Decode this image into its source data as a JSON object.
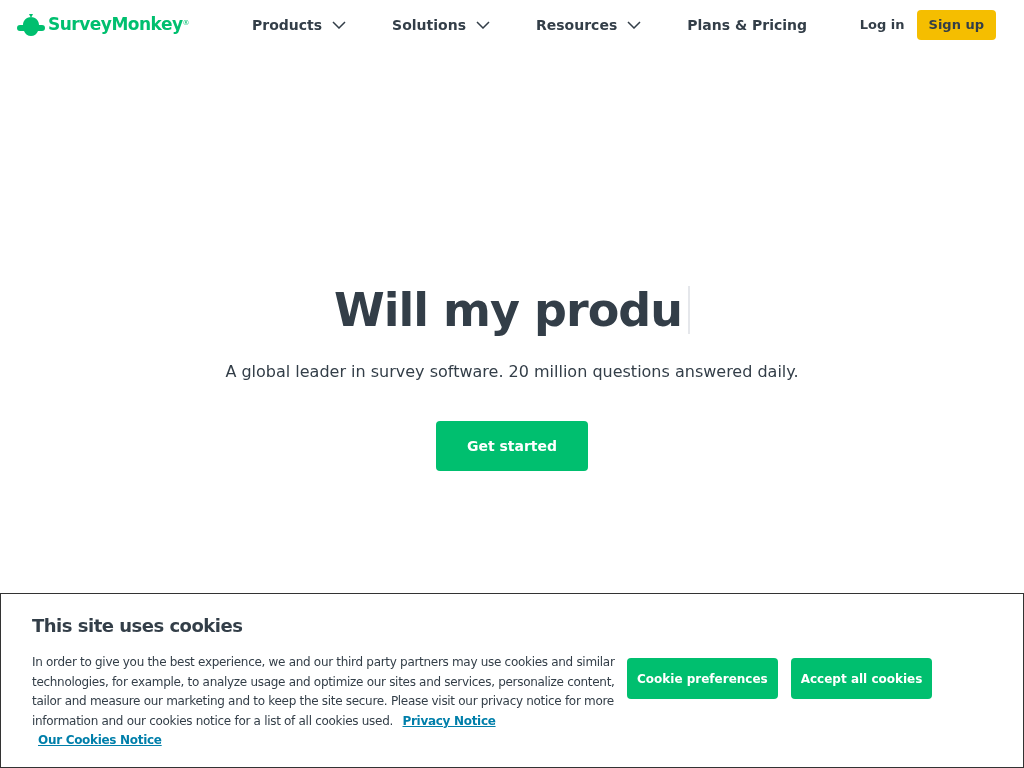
{
  "header": {
    "logo": "SurveyMonkey",
    "logo_mark": "®",
    "nav": [
      {
        "label": "Products",
        "has_dropdown": true
      },
      {
        "label": "Solutions",
        "has_dropdown": true
      },
      {
        "label": "Resources",
        "has_dropdown": true
      },
      {
        "label": "Plans & Pricing",
        "has_dropdown": false
      }
    ],
    "login": "Log in",
    "signup": "Sign up"
  },
  "hero": {
    "headline": "Will my produ",
    "subtitle": "A global leader in survey software. 20 million questions answered daily.",
    "cta": "Get started"
  },
  "cookie_banner": {
    "title": "This site uses cookies",
    "text": "In order to give you the best experience, we and our third party partners may use cookies and similar technologies, for example, to analyze usage and optimize our sites and services, personalize content, tailor and measure our marketing and to keep the site secure. Please visit our privacy notice for more information and our cookies notice for a list of all cookies used.",
    "links": [
      "Privacy Notice",
      "Our Cookies Notice"
    ],
    "buttons": [
      "Cookie preferences",
      "Accept all cookies"
    ]
  }
}
